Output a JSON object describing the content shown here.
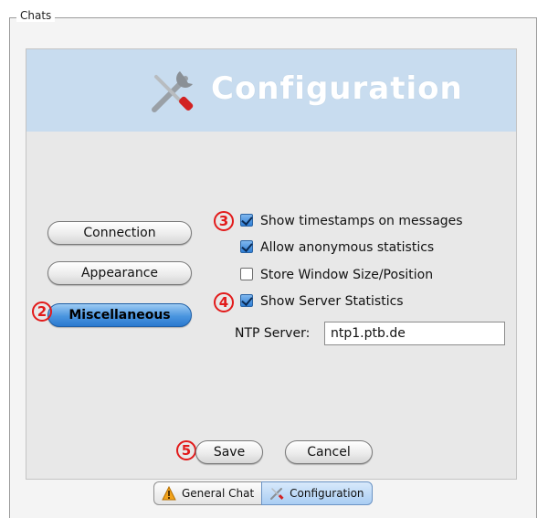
{
  "group": {
    "label": "Chats"
  },
  "banner": {
    "title": "Configuration",
    "icon": "wrench-screwdriver-icon"
  },
  "sidebar": {
    "buttons": [
      {
        "label": "Connection",
        "active": false
      },
      {
        "label": "Appearance",
        "active": false
      },
      {
        "label": "Miscellaneous",
        "active": true
      }
    ]
  },
  "markers": {
    "m2": "2",
    "m3": "3",
    "m4": "4",
    "m5": "5"
  },
  "options": [
    {
      "label": "Show timestamps on messages",
      "checked": true
    },
    {
      "label": "Allow anonymous statistics",
      "checked": true
    },
    {
      "label": "Store Window Size/Position",
      "checked": false
    },
    {
      "label": "Show Server Statistics",
      "checked": true
    }
  ],
  "ntp": {
    "label": "NTP Server:",
    "value": "ntp1.ptb.de"
  },
  "footer": {
    "save_label": "Save",
    "cancel_label": "Cancel"
  },
  "tabs": [
    {
      "label": "General Chat",
      "icon": "warning-icon",
      "selected": false
    },
    {
      "label": "Configuration",
      "icon": "tools-icon",
      "selected": true
    }
  ],
  "colors": {
    "banner": "#c8dcef",
    "accent": "#4a95df",
    "marker": "#e21a1a"
  }
}
